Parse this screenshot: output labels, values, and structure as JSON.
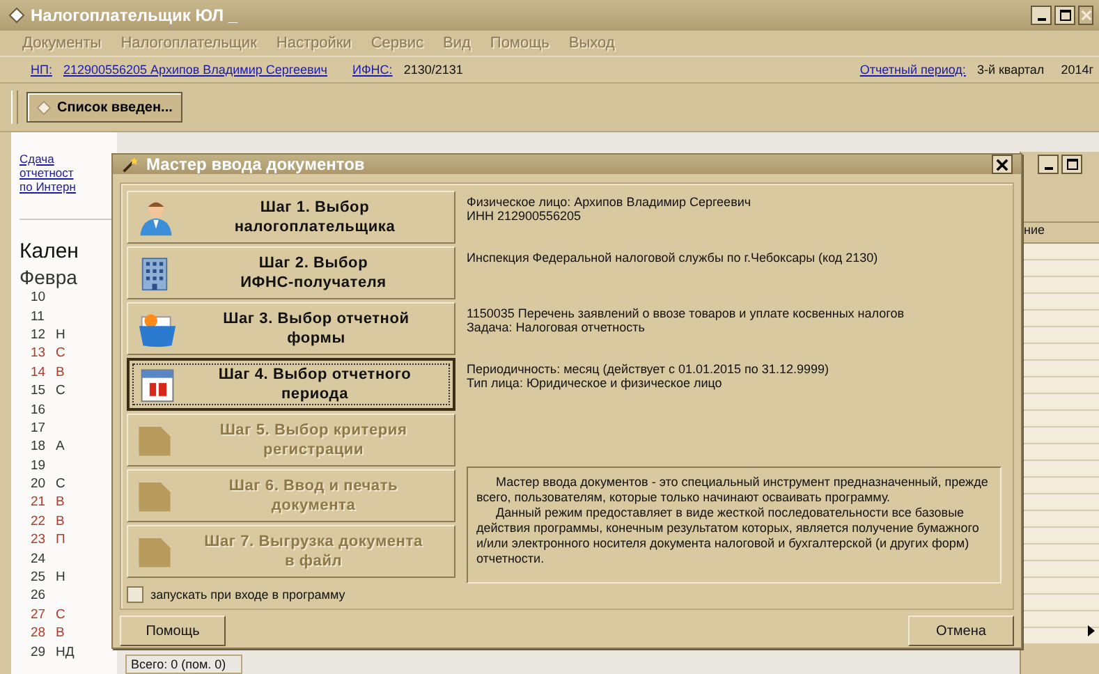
{
  "window": {
    "title": "Налогоплательщик ЮЛ _"
  },
  "menu": [
    {
      "label": "Документы",
      "disabled": true
    },
    {
      "label": "Налогоплательщик",
      "disabled": true
    },
    {
      "label": "Настройки",
      "disabled": true
    },
    {
      "label": "Сервис",
      "disabled": true
    },
    {
      "label": "Вид",
      "disabled": true
    },
    {
      "label": "Помощь",
      "disabled": true
    },
    {
      "label": "Выход",
      "disabled": true
    }
  ],
  "info_bar": {
    "taxpayer_label": "НП:",
    "taxpayer": "212900556205 Архипов Владимир Сергеевич",
    "ifns_label": "ИФНС:",
    "ifns": "2130/2131",
    "period_label": "Отчетный период:",
    "period": "3-й квартал",
    "year": "2014г"
  },
  "toolbar": {
    "tabs": [
      {
        "label": "Список введен...",
        "selected": true
      }
    ]
  },
  "side_panel": {
    "links": [
      "Сдача",
      "отчетност",
      "по Интерн"
    ],
    "heading": "Кален",
    "month": "Февра",
    "days": [
      {
        "day": "10",
        "color": "#333333"
      },
      {
        "day": "11",
        "color": "#333333"
      },
      {
        "day": "12",
        "text": "Н",
        "color": "#333333"
      },
      {
        "day": "13",
        "text": "С",
        "color": "#b03a2a"
      },
      {
        "day": "14",
        "text": "В",
        "color": "#b03a2a"
      },
      {
        "day": "15",
        "text": "С",
        "color": "#333333"
      },
      {
        "day": "16",
        "color": "#333333"
      },
      {
        "day": "17",
        "color": "#333333"
      },
      {
        "day": "18",
        "text": "А",
        "color": "#333333"
      },
      {
        "day": "19",
        "color": "#333333"
      },
      {
        "day": "20",
        "text": "С",
        "color": "#333333"
      },
      {
        "day": "21",
        "text": "В",
        "color": "#b03a2a"
      },
      {
        "day": "22",
        "text": "В",
        "color": "#b03a2a"
      },
      {
        "day": "23",
        "text": "П",
        "color": "#b03a2a"
      },
      {
        "day": "24",
        "color": "#333333"
      },
      {
        "day": "25",
        "text": "Н",
        "color": "#333333"
      },
      {
        "day": "26",
        "color": "#333333"
      },
      {
        "day": "27",
        "text": "С",
        "color": "#b03a2a"
      },
      {
        "day": "28",
        "text": "В",
        "color": "#b03a2a"
      },
      {
        "day": "29",
        "text": "НД",
        "color": "#333333"
      }
    ]
  },
  "status": "Всего: 0 (пом. 0)",
  "back_window": {
    "column": "ние"
  },
  "wizard": {
    "title": "Мастер ввода документов",
    "steps": [
      {
        "lines": [
          "Шаг 1. Выбор",
          "налогоплательщика"
        ],
        "disabled": false,
        "selected": false,
        "info": [
          "Физическое лицо: Архипов Владимир Сергеевич",
          "ИНН 212900556205"
        ]
      },
      {
        "lines": [
          "Шаг 2. Выбор",
          "ИФНС-получателя"
        ],
        "disabled": false,
        "selected": false,
        "info": [
          "Инспекция Федеральной налоговой службы по г.Чебоксары (код 2130)"
        ]
      },
      {
        "lines": [
          "Шаг 3. Выбор отчетной",
          "формы"
        ],
        "disabled": false,
        "selected": false,
        "info": [
          "1150035 Перечень заявлений о ввозе товаров и уплате косвенных налогов",
          "Задача: Налоговая отчетность"
        ]
      },
      {
        "lines": [
          "Шаг 4. Выбор отчетного",
          "периода"
        ],
        "disabled": false,
        "selected": true,
        "info": [
          "Периодичность: месяц (действует с 01.01.2015 по 31.12.9999)",
          "Тип лица: Юридическое и физическое лицо"
        ]
      },
      {
        "lines": [
          "Шаг 5. Выбор критерия",
          "регистрации"
        ],
        "disabled": true,
        "selected": false
      },
      {
        "lines": [
          "Шаг 6. Ввод и печать",
          "документа"
        ],
        "disabled": true,
        "selected": false
      },
      {
        "lines": [
          "Шаг 7. Выгрузка документа",
          "в файл"
        ],
        "disabled": true,
        "selected": false
      }
    ],
    "description": [
      "Мастер ввода документов - это специальный инструмент предназначенный, прежде всего, пользователям, которые только начинают осваивать программу.",
      "Данный режим предоставляет в виде жесткой последовательности все базовые действия программы, конечным результатом которых, является получение бумажного и/или электронного носителя документа налоговой и бухгалтерской (и других форм) отчетности."
    ],
    "autostart": {
      "label": "запускать при входе в программу",
      "checked": false
    },
    "buttons": [
      "Помощь",
      "Отмена"
    ]
  }
}
